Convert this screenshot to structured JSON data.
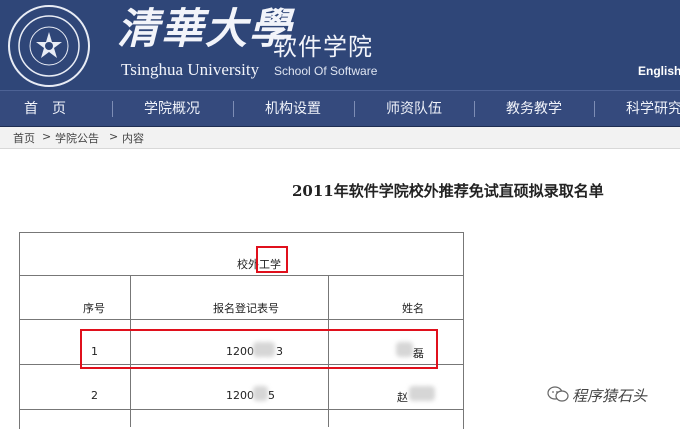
{
  "header": {
    "brand_cn": "清華大學",
    "brand_en": "Tsinghua University",
    "school_cn": "软件学院",
    "school_en": "School Of Software",
    "english_link": "English",
    "bg_color": "#2f4678"
  },
  "nav": {
    "items": [
      {
        "label": "首　页"
      },
      {
        "label": "学院概况"
      },
      {
        "label": "机构设置"
      },
      {
        "label": "师资队伍"
      },
      {
        "label": "教务教学"
      },
      {
        "label": "科学研究"
      }
    ]
  },
  "breadcrumb": {
    "home": "首页",
    "separator": ">",
    "section": "学院公告",
    "current": "内容"
  },
  "article": {
    "title": "2011年软件学院校外推荐免试直硕拟录取名单",
    "table": {
      "caption": "校外工学",
      "headers": [
        "序号",
        "报名登记表号",
        "姓名"
      ],
      "rows": [
        {
          "index": "1",
          "reg_visible": "1200",
          "reg_tail": "3",
          "name_visible": "磊"
        },
        {
          "index": "2",
          "reg_visible": "1200",
          "reg_tail": "5",
          "name_visible": "赵"
        }
      ]
    }
  },
  "watermark": {
    "text": "程序猿石头"
  },
  "highlight_color": "#e0101c"
}
